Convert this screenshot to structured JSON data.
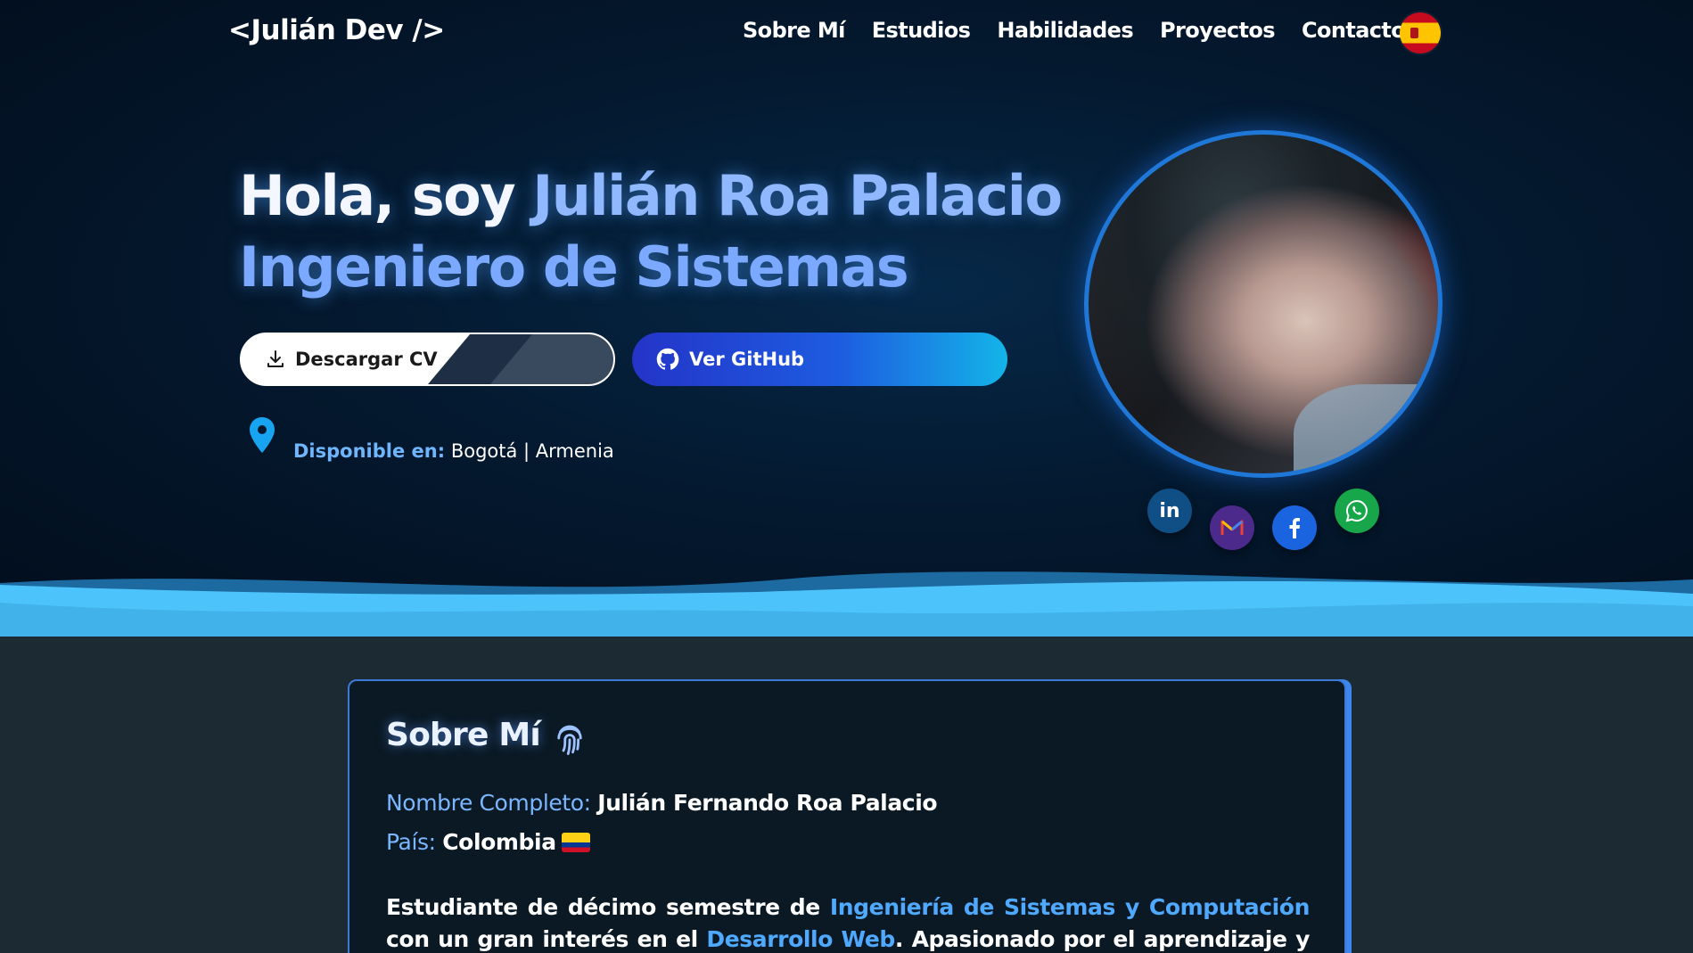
{
  "nav": {
    "logo": "<Julián Dev />",
    "items": [
      {
        "label": "Sobre Mí"
      },
      {
        "label": "Estudios"
      },
      {
        "label": "Habilidades"
      },
      {
        "label": "Proyectos"
      },
      {
        "label": "Contacto"
      }
    ],
    "language_icon": "spain-flag-icon"
  },
  "hero": {
    "greeting": "Hola, soy ",
    "name": "Julián Roa Palacio",
    "role": "Ingeniero de Sistemas",
    "cv_button": "Descargar CV",
    "github_button": "Ver GitHub",
    "location_label": "Disponible en:",
    "location_value": "Bogotá | Armenia",
    "social": [
      "linkedin-icon",
      "gmail-icon",
      "facebook-icon",
      "whatsapp-icon"
    ],
    "linkedin_text": "in"
  },
  "about": {
    "title": "Sobre Mí",
    "full_name_label": "Nombre Completo:",
    "full_name": "Julián Fernando Roa Palacio",
    "country_label": "País:",
    "country": "Colombia",
    "para_1": "Estudiante de décimo semestre de ",
    "para_hl1": "Ingeniería de Sistemas y Computación",
    "para_2": " con un gran interés en el ",
    "para_hl2": "Desarrollo Web",
    "para_3": ". Apasionado por el aprendizaje y el"
  },
  "colors": {
    "accent": "#7aa9ff",
    "highlight": "#4fa9ff",
    "wave": "#4cc4fb"
  }
}
